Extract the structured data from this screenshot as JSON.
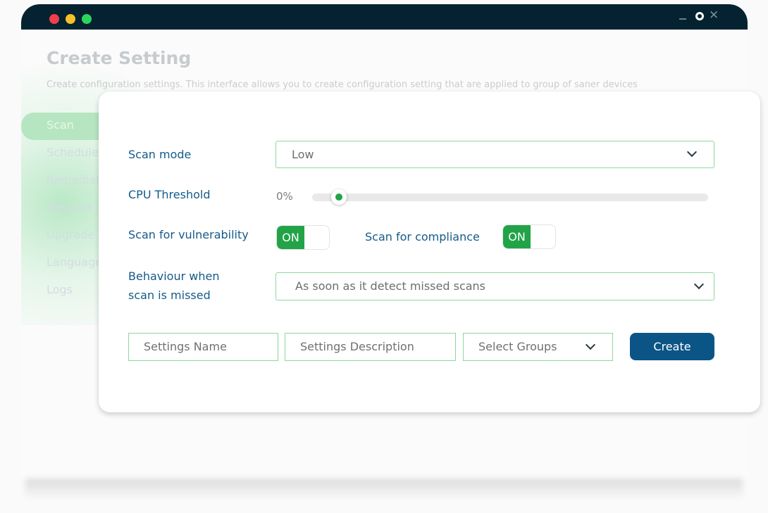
{
  "window": {
    "controls": {
      "minimize": "_",
      "maximize": "o",
      "close": "×"
    }
  },
  "page": {
    "title": "Create Setting",
    "subtitle": "Create configuration settings. This interface allows you to create configuration setting that are applied to group of saner devices"
  },
  "sidebar": {
    "items": [
      {
        "label": "Scan",
        "active": true
      },
      {
        "label": "Schedule"
      },
      {
        "label": "Remediation"
      },
      {
        "label": "Network"
      },
      {
        "label": "Upgrade"
      },
      {
        "label": "Language"
      },
      {
        "label": "Logs"
      }
    ]
  },
  "form": {
    "scan_mode": {
      "label": "Scan mode",
      "value": "Low"
    },
    "cpu_threshold": {
      "label": "CPU Threshold",
      "value_text": "0%",
      "value_fraction": 0.02
    },
    "scan_vulnerability": {
      "label": "Scan for vulnerability",
      "state": "ON"
    },
    "scan_compliance": {
      "label": "Scan for compliance",
      "state": "ON"
    },
    "missed_behaviour": {
      "label_line1": "Behaviour when",
      "label_line2": "scan is missed",
      "value": "As soon as it detect missed scans"
    },
    "settings_name": {
      "placeholder": "Settings Name"
    },
    "settings_description": {
      "placeholder": "Settings Description"
    },
    "select_groups": {
      "placeholder": "Select Groups"
    },
    "create_label": "Create"
  },
  "colors": {
    "titlebar": "#052230",
    "accent_green": "#22a348",
    "primary_blue": "#0b5586",
    "label_blue": "#155a8a",
    "input_border": "#8fd69d"
  }
}
